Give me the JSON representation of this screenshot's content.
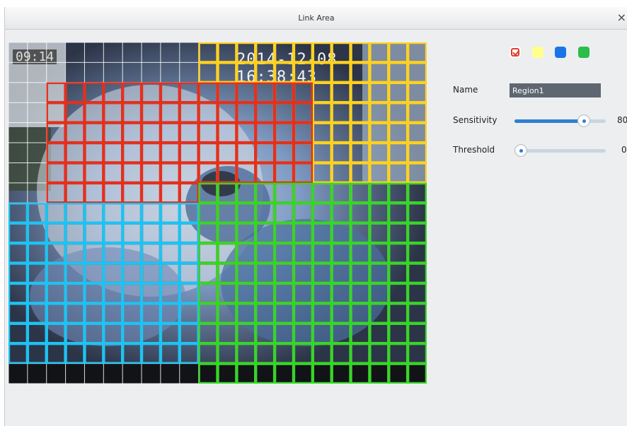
{
  "window": {
    "title": "Link Area",
    "close_glyph": "×"
  },
  "video": {
    "osd_time": "2014-12-08 16:38:43",
    "osd_name": "09:14",
    "grid": {
      "cols": 22,
      "rows": 17
    },
    "regions": [
      {
        "color_name": "yellow",
        "color": "#ffd21f",
        "col_start": 10,
        "col_end": 21,
        "row_start": 0,
        "row_end": 7
      },
      {
        "color_name": "red",
        "color": "#e3301e",
        "col_start": 2,
        "col_end": 15,
        "row_start": 2,
        "row_end": 12
      },
      {
        "color_name": "blue",
        "color": "#1ec3f2",
        "col_start": 0,
        "col_end": 9,
        "row_start": 8,
        "row_end": 15
      },
      {
        "color_name": "green",
        "color": "#39d42a",
        "col_start": 10,
        "col_end": 21,
        "row_start": 7,
        "row_end": 16
      }
    ]
  },
  "panel": {
    "swatches": [
      {
        "name": "red",
        "color": "#e23b2b",
        "selected": true
      },
      {
        "name": "yellow",
        "color": "#ffff8c",
        "selected": false
      },
      {
        "name": "blue",
        "color": "#1a74e8",
        "selected": false
      },
      {
        "name": "green",
        "color": "#2bbd4a",
        "selected": false
      }
    ],
    "name_label": "Name",
    "name_value": "Region1",
    "sensitivity": {
      "label": "Sensitivity",
      "value": 80,
      "max": 100,
      "display": "80"
    },
    "threshold": {
      "label": "Threshold",
      "value": 0,
      "max": 100,
      "display": "0"
    }
  }
}
